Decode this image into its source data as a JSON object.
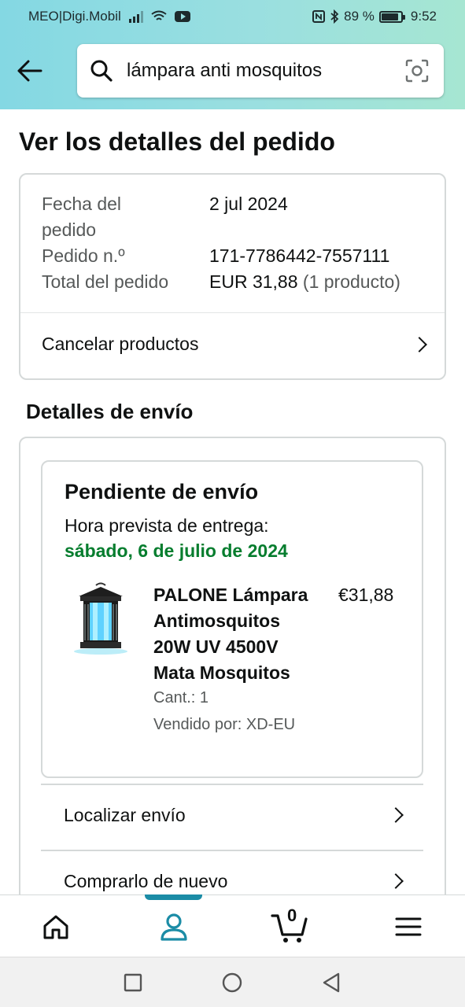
{
  "status_bar": {
    "carrier": "MEO|Digi.Mobil",
    "battery": "89 %",
    "battery_level": 0.89,
    "time": "9:52"
  },
  "search": {
    "query": "lámpara anti mosquitos"
  },
  "page_title": "Ver los detalles del pedido",
  "order": {
    "date_label_line1": "Fecha del",
    "date_label_line2": "pedido",
    "date_value": "2 jul 2024",
    "number_label": "Pedido n.º",
    "number_value": "171-7786442-7557111",
    "total_label": "Total del pedido",
    "total_value": "EUR 31,88",
    "total_count": "(1 producto)",
    "cancel_label": "Cancelar productos"
  },
  "shipping": {
    "section_title": "Detalles de envío",
    "status": "Pendiente de envío",
    "eta_label": "Hora prevista de entrega:",
    "eta_date": "sábado, 6 de julio de 2024",
    "product": {
      "name_line1": "PALONE Lámpara",
      "name_line2": "Antimosquitos",
      "name_line3": "20W UV 4500V",
      "name_line4": "Mata Mosquitos",
      "price": "€31,88",
      "quantity": "Cant.: 1",
      "seller": "Vendido por: XD-EU"
    },
    "track_label": "Localizar envío",
    "buy_again_label": "Comprarlo de nuevo"
  },
  "bottom_nav": {
    "cart_count": "0",
    "active": "account"
  },
  "colors": {
    "accent": "#1b8ca6",
    "eta_green": "#067d2e",
    "header_from": "#84d8e3",
    "header_to": "#a6e6d2"
  }
}
